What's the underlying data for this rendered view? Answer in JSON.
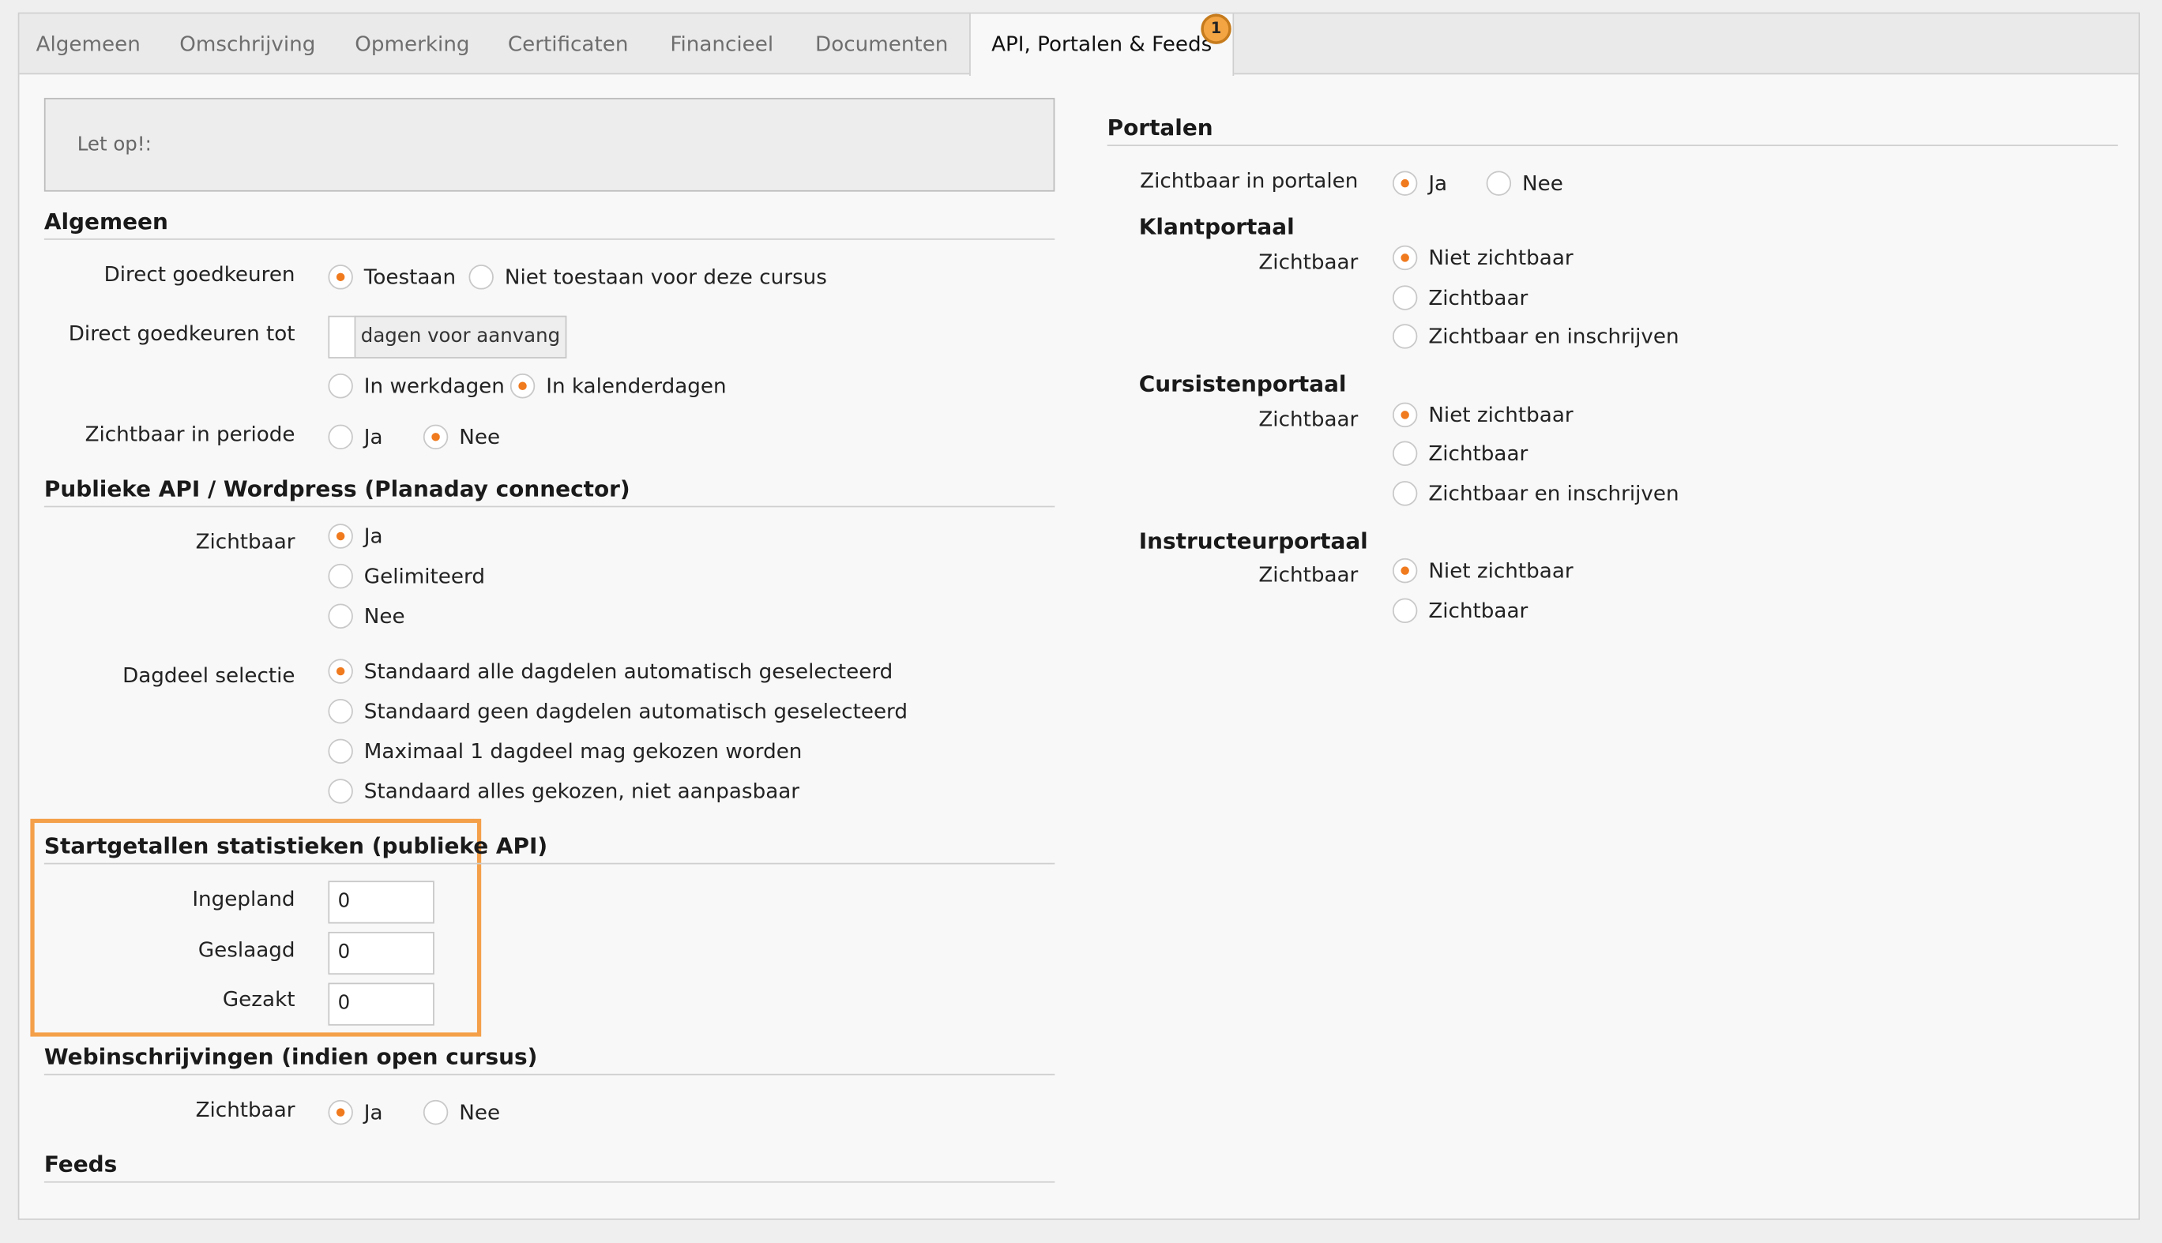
{
  "tabs": [
    {
      "label": "Algemeen",
      "active": false
    },
    {
      "label": "Omschrijving",
      "active": false
    },
    {
      "label": "Opmerking",
      "active": false
    },
    {
      "label": "Certificaten",
      "active": false
    },
    {
      "label": "Financieel",
      "active": false
    },
    {
      "label": "Documenten",
      "active": false
    },
    {
      "label": "API, Portalen & Feeds",
      "active": true
    }
  ],
  "badge": "1",
  "notice": "Let op!:",
  "algemeen": {
    "title": "Algemeen",
    "direct_goedkeuren": {
      "label": "Direct goedkeuren",
      "options": [
        "Toestaan",
        "Niet toestaan voor deze cursus"
      ],
      "selected": 0
    },
    "direct_tot": {
      "label": "Direct goedkeuren tot",
      "value": "",
      "addon": "dagen voor aanvang",
      "options": [
        "In werkdagen",
        "In kalenderdagen"
      ],
      "selected": 1
    },
    "zichtbaar_periode": {
      "label": "Zichtbaar in periode",
      "options": [
        "Ja",
        "Nee"
      ],
      "selected": 1
    }
  },
  "api": {
    "title": "Publieke API / Wordpress (Planaday connector)",
    "zichtbaar": {
      "label": "Zichtbaar",
      "options": [
        "Ja",
        "Gelimiteerd",
        "Nee"
      ],
      "selected": 0
    },
    "dagdeel": {
      "label": "Dagdeel selectie",
      "options": [
        "Standaard alle dagdelen automatisch geselecteerd",
        "Standaard geen dagdelen automatisch geselecteerd",
        "Maximaal 1 dagdeel mag gekozen worden",
        "Standaard alles gekozen, niet aanpasbaar"
      ],
      "selected": 0
    }
  },
  "stats": {
    "title": "Startgetallen statistieken (publieke API)",
    "fields": [
      {
        "label": "Ingepland",
        "value": "0"
      },
      {
        "label": "Geslaagd",
        "value": "0"
      },
      {
        "label": "Gezakt",
        "value": "0"
      }
    ]
  },
  "web": {
    "title": "Webinschrijvingen (indien open cursus)",
    "zichtbaar": {
      "label": "Zichtbaar",
      "options": [
        "Ja",
        "Nee"
      ],
      "selected": 0
    }
  },
  "feeds": {
    "title": "Feeds"
  },
  "portalen": {
    "title": "Portalen",
    "zichtbaar": {
      "label": "Zichtbaar in portalen",
      "options": [
        "Ja",
        "Nee"
      ],
      "selected": 0
    },
    "klant": {
      "title": "Klantportaal",
      "label": "Zichtbaar",
      "options": [
        "Niet zichtbaar",
        "Zichtbaar",
        "Zichtbaar en inschrijven"
      ],
      "selected": 0
    },
    "cursist": {
      "title": "Cursistenportaal",
      "label": "Zichtbaar",
      "options": [
        "Niet zichtbaar",
        "Zichtbaar",
        "Zichtbaar en inschrijven"
      ],
      "selected": 0
    },
    "instructeur": {
      "title": "Instructeurportaal",
      "label": "Zichtbaar",
      "options": [
        "Niet zichtbaar",
        "Zichtbaar"
      ],
      "selected": 0
    }
  }
}
